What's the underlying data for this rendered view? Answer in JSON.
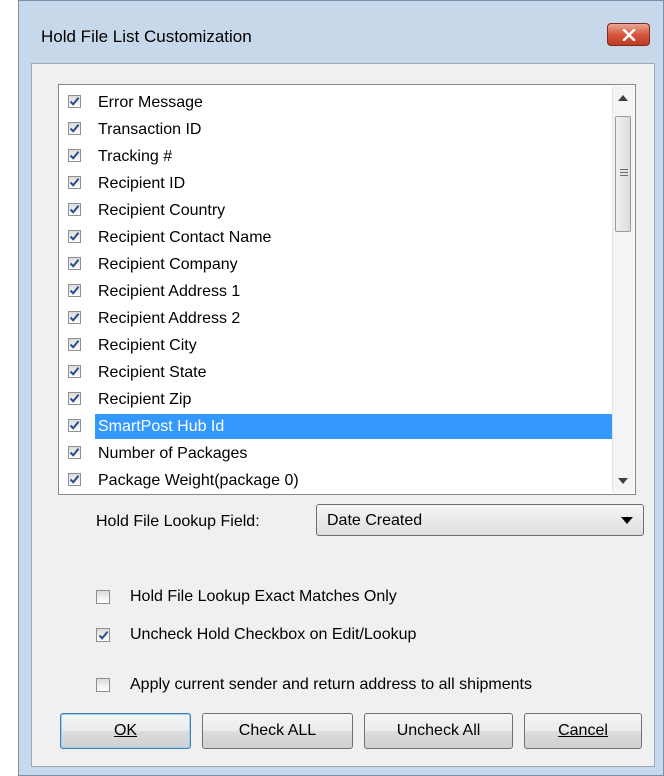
{
  "window": {
    "title": "Hold File List Customization"
  },
  "icons": {
    "close": "close-x-icon",
    "check": "checkmark-icon",
    "dropdown": "chevron-down-icon"
  },
  "colors": {
    "selection": "#3399ff",
    "titlebar": "#c6d8ea",
    "close_button": "#d6573f"
  },
  "list": {
    "items": [
      {
        "label": "Error Message",
        "checked": true
      },
      {
        "label": "Transaction ID",
        "checked": true
      },
      {
        "label": "Tracking #",
        "checked": true
      },
      {
        "label": "Recipient ID",
        "checked": true
      },
      {
        "label": "Recipient Country",
        "checked": true
      },
      {
        "label": "Recipient Contact Name",
        "checked": true
      },
      {
        "label": "Recipient Company",
        "checked": true
      },
      {
        "label": "Recipient Address 1",
        "checked": true
      },
      {
        "label": "Recipient Address 2",
        "checked": true
      },
      {
        "label": "Recipient City",
        "checked": true
      },
      {
        "label": "Recipient State",
        "checked": true
      },
      {
        "label": "Recipient Zip",
        "checked": true
      },
      {
        "label": "SmartPost Hub Id",
        "checked": true,
        "selected": true
      },
      {
        "label": "Number of Packages",
        "checked": true
      },
      {
        "label": "Package Weight(package 0)",
        "checked": true
      }
    ]
  },
  "lookup_field": {
    "label": "Hold File Lookup Field:",
    "value": "Date Created"
  },
  "options": {
    "exact_matches": {
      "label": "Hold File Lookup Exact Matches Only",
      "checked": false
    },
    "uncheck_hold": {
      "label": "Uncheck Hold Checkbox on Edit/Lookup",
      "checked": true
    },
    "apply_address": {
      "label": "Apply current sender and return address to all shipments",
      "checked": false
    }
  },
  "buttons": {
    "ok": "OK",
    "check_all": "Check ALL",
    "uncheck_all": "Uncheck All",
    "cancel": "Cancel"
  }
}
